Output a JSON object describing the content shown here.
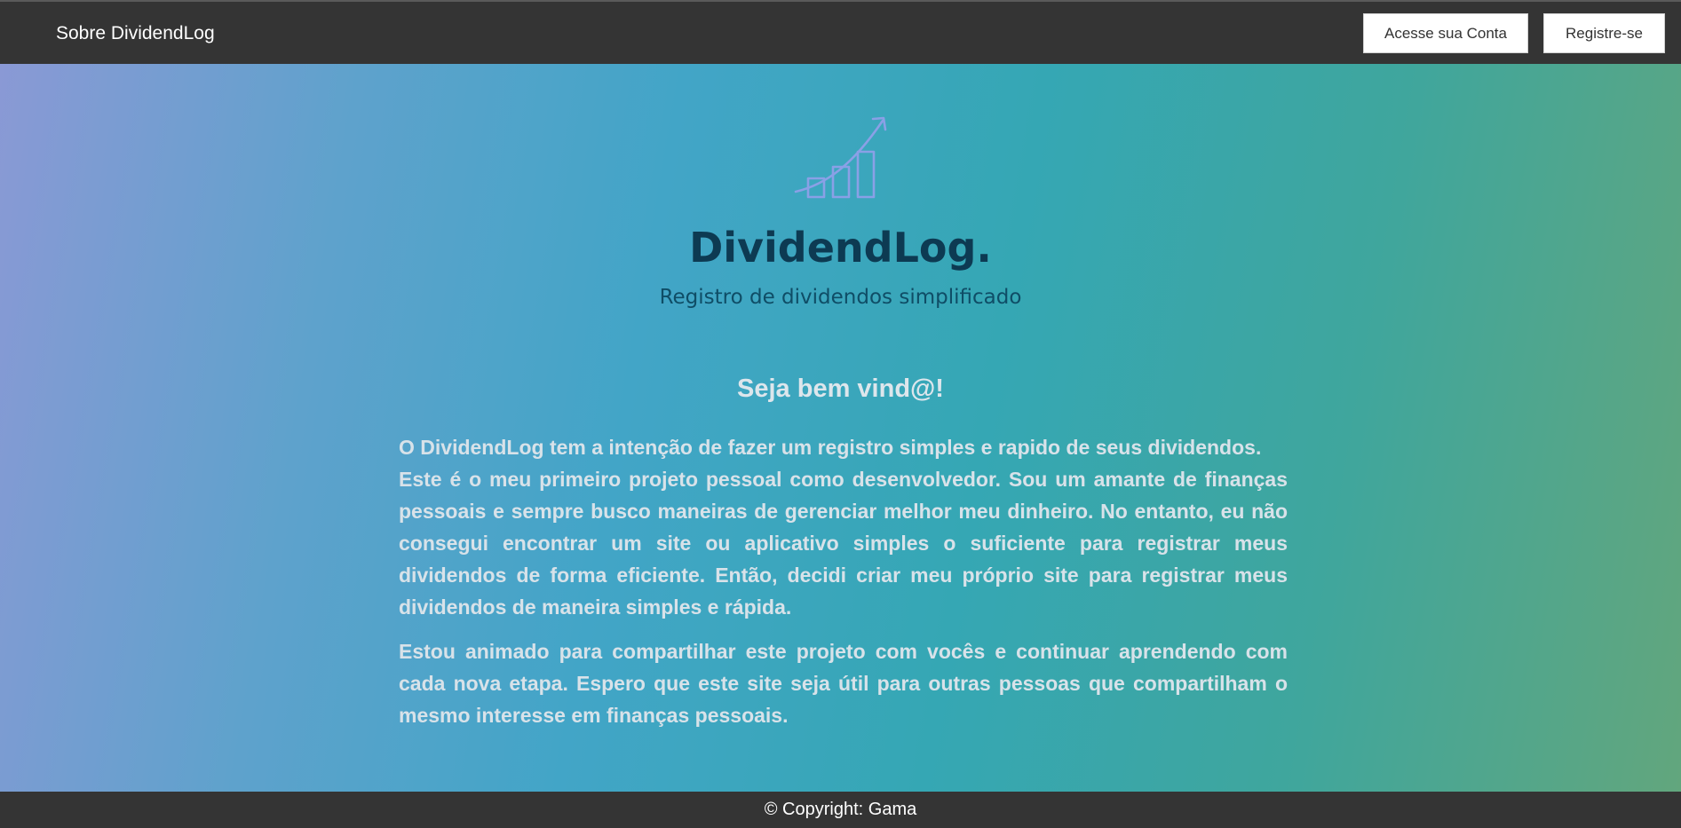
{
  "navbar": {
    "brand_label": "Sobre DividendLog",
    "login_label": "Acesse sua Conta",
    "register_label": "Registre-se"
  },
  "hero": {
    "logo_icon": "rising-chart-icon",
    "title": "DividendLog.",
    "subtitle": "Registro de dividendos simplificado"
  },
  "intro": {
    "heading": "Seja bem vind@!",
    "line1": "O DividendLog tem a intenção de fazer um registro simples e rapido de seus dividendos.",
    "line2": "Este é o meu primeiro projeto pessoal como desenvolvedor. Sou um amante de finanças pessoais e sempre busco maneiras de gerenciar melhor meu dinheiro. No entanto, eu não consegui encontrar um site ou aplicativo simples o suficiente para registrar meus dividendos de forma eficiente. Então, decidi criar meu próprio site para registrar meus dividendos de maneira simples e rápida.",
    "paragraph2": "Estou animado para compartilhar este projeto com vocês e continuar aprendendo com cada nova etapa. Espero que este site seja útil para outras pessoas que compartilham o mesmo interesse em finanças pessoais."
  },
  "footer": {
    "copyright": "© Copyright: Gama"
  },
  "colors": {
    "navbar_bg": "#343434",
    "title": "#0d3a52",
    "logo_stroke": "#8aa0e6",
    "body_text": "#d8e2e9"
  }
}
